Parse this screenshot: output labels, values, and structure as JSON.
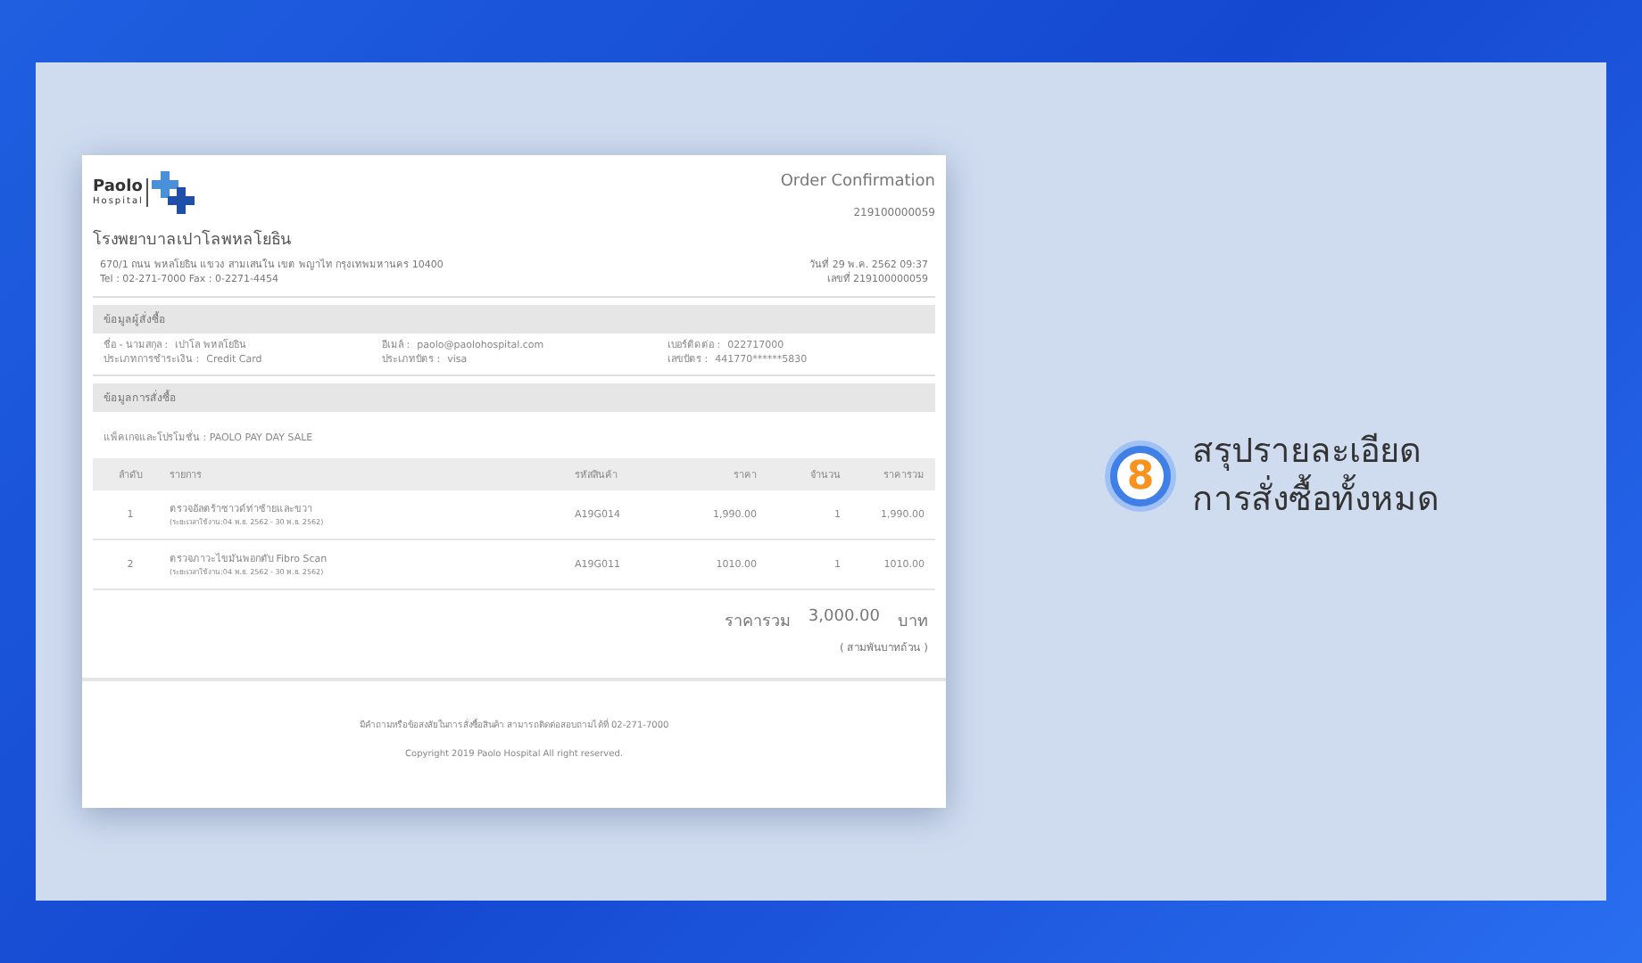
{
  "logo": {
    "name": "Paolo",
    "subtitle": "Hospital"
  },
  "document": {
    "title": "Order Confirmation",
    "order_number": "219100000059",
    "hospital_name": "โรงพยาบาลเปาโลพหลโยธิน",
    "address": "670/1 ถนน พหลโยธิน แขวง สามเสนใน เขต พญาไท กรุงเทพมหานคร 10400",
    "phone": "Tel : 02-271-7000 Fax : 0-2271-4454",
    "date": "วันที่ 29 พ.ค. 2562 09:37",
    "reference": "เลขที่ 219100000059",
    "buyer_section": {
      "title": "ข้อมูลผู้สั่งซื้อ",
      "fields": [
        {
          "label": "ชื่อ - นามสกุล :",
          "value": "เปาโล พหลโยธิน"
        },
        {
          "label": "อีเมล์ :",
          "value": "paolo@paolohospital.com"
        },
        {
          "label": "เบอร์ติดต่อ :",
          "value": "022717000"
        },
        {
          "label": "ประเภทการชำระเงิน :",
          "value": "Credit Card"
        },
        {
          "label": "ประเภทบัตร :",
          "value": "visa"
        },
        {
          "label": "เลขบัตร :",
          "value": "441770******5830"
        }
      ]
    },
    "order_section": {
      "title": "ข้อมูลการสั่งซื้อ",
      "package": "แพ็คเกจและโปรโมชั่น : PAOLO PAY DAY SALE",
      "columns": [
        "ลำดับ",
        "รายการ",
        "รหัสสินค้า",
        "ราคา",
        "จำนวน",
        "ราคารวม"
      ],
      "rows": [
        {
          "no": "1",
          "item": "ตรวจอัลตร้าซาวด์ท่าซ้ายและขวา",
          "period": "(ระยะเวลาใช้งาน:04 พ.ย. 2562 - 30 พ.ย. 2562)",
          "code": "A19G014",
          "price": "1,990.00",
          "qty": "1",
          "total": "1,990.00"
        },
        {
          "no": "2",
          "item": "ตรวจภาวะไขมันพอกตับ Fibro Scan",
          "period": "(ระยะเวลาใช้งาน:04 พ.ย. 2562 - 30 พ.ย. 2562)",
          "code": "A19G011",
          "price": "1010.00",
          "qty": "1",
          "total": "1010.00"
        }
      ],
      "total_label": "ราคารวม",
      "total_value": "3,000.00",
      "currency": "บาท",
      "total_words": "( สามพันบาทถ้วน )"
    },
    "footer": {
      "contact": "มีคำถามหรือข้อสงสัยในการสั่งซื้อสินค้า สามารถติดต่อสอบถามได้ที่ 02-271-7000",
      "copyright": "Copyright 2019 Paolo Hospital All right reserved."
    }
  },
  "step": {
    "number": "8",
    "title_lines": [
      "สรุปรายละเอียด",
      "การสั่งซื้อทั้งหมด"
    ]
  }
}
